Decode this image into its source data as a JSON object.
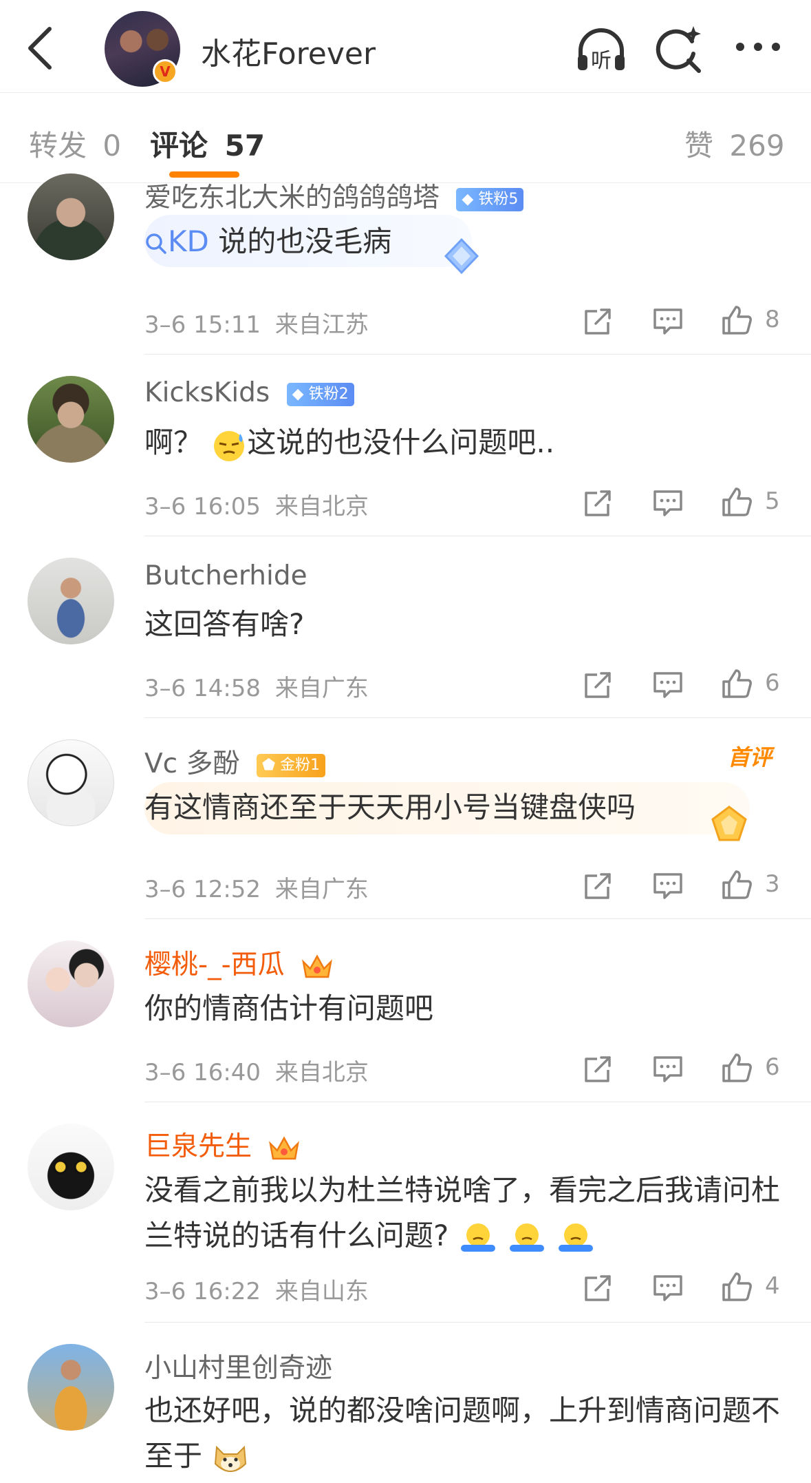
{
  "header": {
    "title": "水花Forever",
    "verified_mark": "V",
    "icons": [
      "back-icon",
      "listen-icon",
      "search-icon",
      "more-icon"
    ]
  },
  "tabs": [
    {
      "label": "转发",
      "count": "0"
    },
    {
      "label": "评论",
      "count": "57"
    },
    {
      "label": "赞",
      "count": "269"
    }
  ],
  "comments": [
    {
      "user": "爱吃东北大米的鸽鸽鸽塔",
      "badge": "铁粉5",
      "text_link": "KD",
      "text": "说的也没毛病",
      "time": "3–6 15:11",
      "location": "来自江苏",
      "likes": "8"
    },
    {
      "user": "KicksKids",
      "badge": "铁粉2",
      "text_pre": "啊？",
      "text": "这说的也没什么问题吧..",
      "time": "3–6 16:05",
      "location": "来自北京",
      "likes": "5"
    },
    {
      "user": "Butcherhide",
      "text": "这回答有啥?",
      "time": "3–6 14:58",
      "location": "来自广东",
      "likes": "6"
    },
    {
      "user": "Vc 多酚",
      "badge": "金粉1",
      "tag": "首评",
      "text": "有这情商还至于天天用小号当键盘侠吗",
      "time": "3–6 12:52",
      "location": "来自广东",
      "likes": "3"
    },
    {
      "user": "樱桃-_-西瓜",
      "text": "你的情商估计有问题吧",
      "time": "3–6 16:40",
      "location": "来自北京",
      "likes": "6"
    },
    {
      "user": "巨泉先生",
      "text": "没看之前我以为杜兰特说啥了，看完之后我请问杜兰特说的话有什么问题?",
      "time": "3–6 16:22",
      "location": "来自山东",
      "likes": "4"
    },
    {
      "user": "小山村里创奇迹",
      "text": "也还好吧，说的都没啥问题啊，上升到情商问题不至于"
    }
  ],
  "colors": {
    "accent": "#ff8200",
    "orange_name": "#f35c0a",
    "meta": "#999999"
  }
}
